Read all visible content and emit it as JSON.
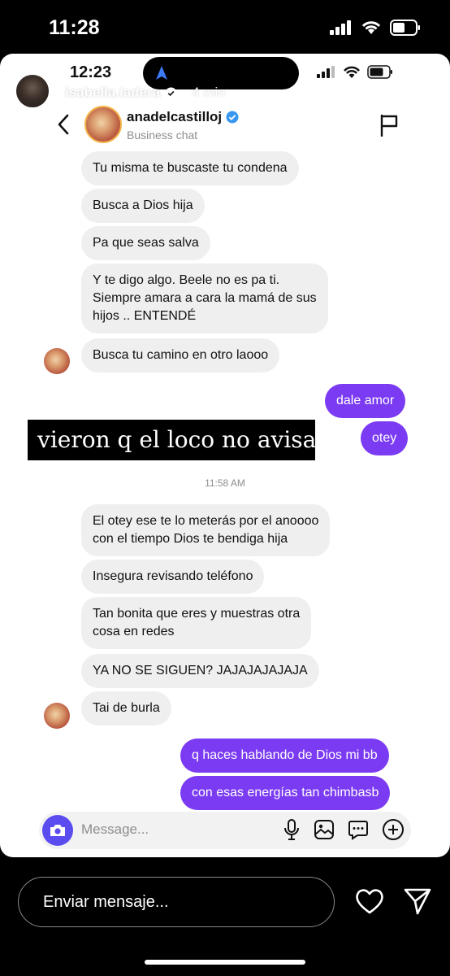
{
  "outer_status": {
    "time": "11:28"
  },
  "inner_status": {
    "time": "12:23"
  },
  "story": {
    "username": "isabella.ladera",
    "age": "4 min"
  },
  "chat_header": {
    "name": "anadelcastilloj",
    "subtitle": "Business chat"
  },
  "messages": [
    {
      "text": "Tu misma te buscaste tu condena"
    },
    {
      "text": "Busca a Dios hija"
    },
    {
      "text": "Pa que seas salva"
    },
    {
      "text": "Y te digo algo. Beele no es pa ti.\nSiempre amara a cara la mamá de sus\nhijos .. ENTENDÉ"
    },
    {
      "text": "Busca tu camino en otro laooo"
    },
    {
      "text": "dale amor"
    },
    {
      "text": "otey"
    },
    {
      "text": "El otey ese te lo meterás por el anoooo\ncon el tiempo Dios te bendiga hija"
    },
    {
      "text": "Insegura revisando teléfono"
    },
    {
      "text": "Tan bonita que eres y muestras otra\ncosa en redes"
    },
    {
      "text": "YA NO SE SIGUEN? JAJAJAJAJAJA"
    },
    {
      "text": "Tai de burla"
    },
    {
      "text": "q haces hablando de Dios mi bb"
    },
    {
      "text": "con esas energías tan chimbasb"
    }
  ],
  "timestamp": "11:58 AM",
  "caption": "vieron q el loco no avisa",
  "composer": {
    "placeholder": "Message..."
  },
  "reply": {
    "placeholder": "Enviar mensaje..."
  },
  "colors": {
    "outgoing_bubble": "#7b3bf2",
    "incoming_bubble": "#efefef",
    "camera_button": "#5b4cf0",
    "verified": "#3897f0"
  }
}
